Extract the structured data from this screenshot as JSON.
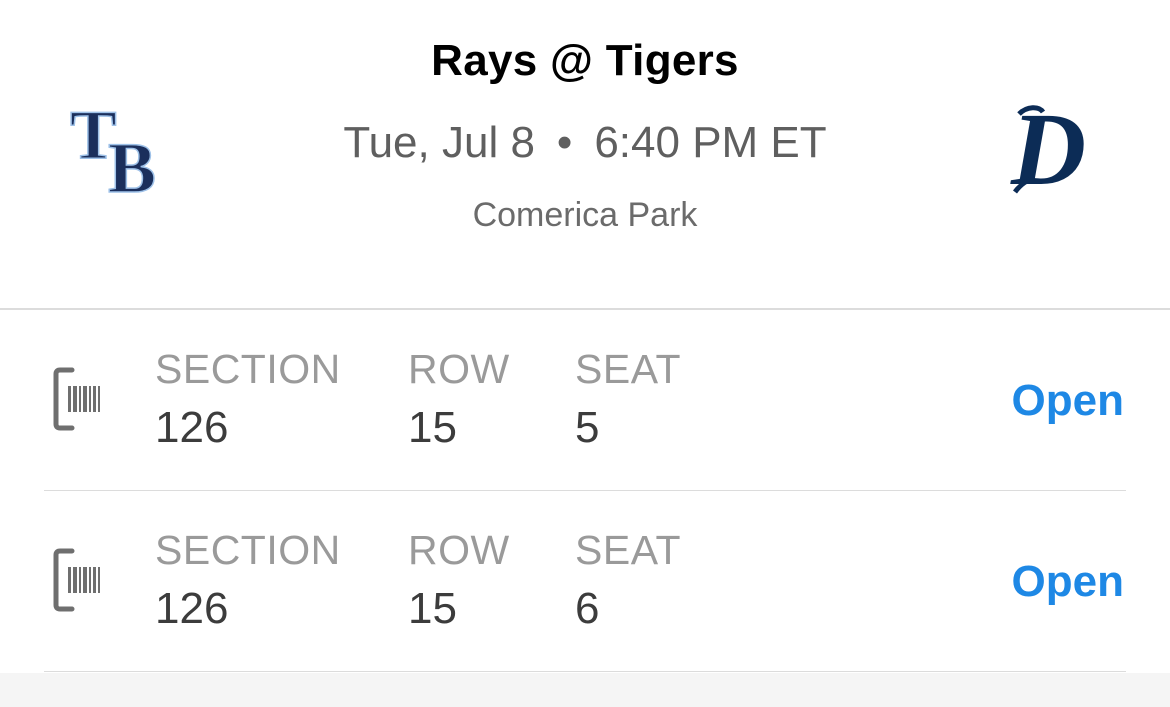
{
  "event": {
    "title": "Rays @ Tigers",
    "date": "Tue, Jul 8",
    "separator": "•",
    "time": "6:40 PM ET",
    "venue": "Comerica Park"
  },
  "teams": {
    "away": {
      "logo_text": "TB",
      "logo_icon": "rays-tb-logo",
      "color": "#1b2f5c"
    },
    "home": {
      "logo_text": "D",
      "logo_icon": "tigers-d-logo",
      "color": "#0c2c56"
    }
  },
  "tickets": [
    {
      "icon": "barcode-ticket-icon",
      "section_label": "SECTION",
      "section": "126",
      "row_label": "ROW",
      "row": "15",
      "seat_label": "SEAT",
      "seat": "5",
      "action": "Open"
    },
    {
      "icon": "barcode-ticket-icon",
      "section_label": "SECTION",
      "section": "126",
      "row_label": "ROW",
      "row": "15",
      "seat_label": "SEAT",
      "seat": "6",
      "action": "Open"
    }
  ],
  "colors": {
    "accent": "#1e88e5",
    "label_gray": "#9a9a9a",
    "value_dark": "#3c3c3c"
  }
}
